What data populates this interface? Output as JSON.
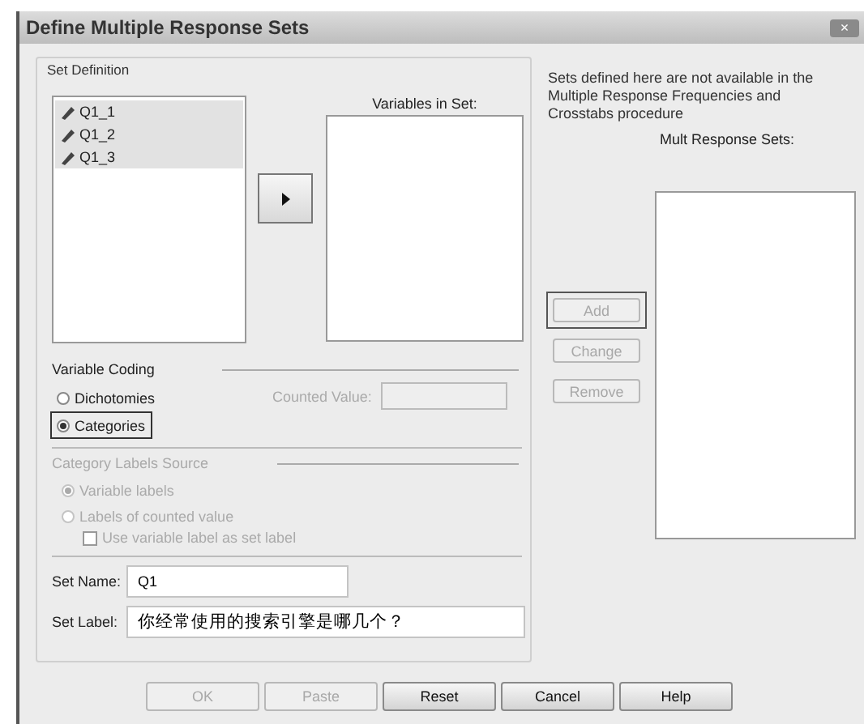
{
  "window": {
    "title": "Define Multiple Response Sets",
    "close": "×"
  },
  "set_definition": {
    "legend": "Set Definition",
    "source_variables": [
      {
        "name": "Q1_1",
        "selected": true
      },
      {
        "name": "Q1_2",
        "selected": true
      },
      {
        "name": "Q1_3",
        "selected": true
      }
    ],
    "variables_in_set_label": "Variables in Set:",
    "variable_coding": {
      "legend": "Variable Coding",
      "options": [
        {
          "label": "Dichotomies",
          "selected": false,
          "focused": false
        },
        {
          "label": "Categories",
          "selected": true,
          "focused": true
        }
      ],
      "counted_value": {
        "label": "Counted Value:",
        "disabled": true
      }
    },
    "category_labels_source": {
      "legend": "Category Labels Source",
      "disabled": true,
      "options": [
        {
          "label": "Variable labels",
          "selected": true
        },
        {
          "label": "Labels of counted value",
          "selected": false
        }
      ],
      "checkbox": {
        "label": "Use variable label as set label",
        "checked": false
      }
    },
    "set_name": {
      "label": "Set Name:",
      "value": "Q1"
    },
    "set_label": {
      "label": "Set Label:",
      "value": "你经常使用的搜索引擎是哪几个？"
    }
  },
  "note": "Sets defined here are not available in the Multiple Response Frequencies and Crosstabs procedure",
  "mult_response_sets_label": "Mult Response Sets:",
  "set_buttons": [
    {
      "label": "Add",
      "disabled": true,
      "focused": true
    },
    {
      "label": "Change",
      "disabled": true,
      "focused": false
    },
    {
      "label": "Remove",
      "disabled": true,
      "focused": false
    }
  ],
  "buttons": [
    {
      "label": "OK",
      "disabled": true
    },
    {
      "label": "Paste",
      "disabled": true
    },
    {
      "label": "Reset",
      "disabled": false
    },
    {
      "label": "Cancel",
      "disabled": false
    },
    {
      "label": "Help",
      "disabled": false
    }
  ]
}
